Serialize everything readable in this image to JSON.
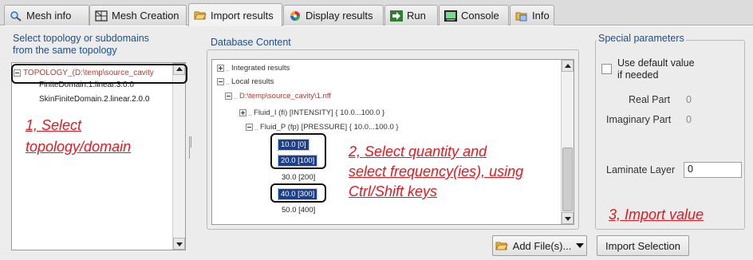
{
  "tabs": [
    {
      "label": "Mesh info",
      "icon": "magnifier-icon",
      "active": false
    },
    {
      "label": "Mesh Creation",
      "icon": "mesh-grid-icon",
      "active": false
    },
    {
      "label": "Import results",
      "icon": "folder-open-icon",
      "active": true
    },
    {
      "label": "Display results",
      "icon": "color-wheel-icon",
      "active": false
    },
    {
      "label": "Run",
      "icon": "run-arrow-icon",
      "active": false
    },
    {
      "label": "Console",
      "icon": "console-icon",
      "active": false
    },
    {
      "label": "Info",
      "icon": "info-folder-icon",
      "active": false
    }
  ],
  "left_panel": {
    "title": "Select topology or subdomains\nfrom the same topology",
    "items": [
      {
        "label": "TOPOLOGY_(D:\\temp\\source_cavity",
        "selected": true,
        "expanded": true
      },
      {
        "label": "FiniteDomain.1.linear.3.0.0"
      },
      {
        "label": "SkinFiniteDomain.2.linear.2.0.0"
      }
    ]
  },
  "db": {
    "title": "Database Content",
    "tree": [
      {
        "label": "Integrated results",
        "expander": "plus"
      },
      {
        "label": "Local results",
        "expander": "minus"
      },
      {
        "label": "D:\\temp\\source_cavity\\1.nff",
        "expander": "minus"
      },
      {
        "label": "Fluid_I (fi) [INTENSITY] { 10.0...100.0 }",
        "expander": "plus"
      },
      {
        "label": "Fluid_P (fp) [PRESSURE] { 10.0...100.0 }",
        "expander": "minus"
      }
    ],
    "frequencies": [
      {
        "label": "10.0 [0]",
        "selected": true
      },
      {
        "label": "20.0 [100]",
        "selected": true
      },
      {
        "label": "30.0 [200]",
        "selected": false
      },
      {
        "label": "40.0 [300]",
        "selected": true
      },
      {
        "label": "50.0 [400]",
        "selected": false
      }
    ]
  },
  "special": {
    "title": "Special parameters",
    "use_default_label": "Use default value\nif needed",
    "use_default_checked": false,
    "real_part_label": "Real Part",
    "real_part_value": "0",
    "imaginary_part_label": "Imaginary Part",
    "imaginary_part_value": "0",
    "laminate_label": "Laminate Layer",
    "laminate_value": "0"
  },
  "buttons": {
    "add_files": "Add File(s)...",
    "import_selection": "Import Selection"
  },
  "annotations": {
    "step1_line1": "1, Select",
    "step1_line2": "topology/domain",
    "step2_line1": "2, Select quantity and",
    "step2_line2": "select frequency(ies), using",
    "step2_line3": "Ctrl/Shift keys",
    "step3": "3, Import value"
  },
  "colors": {
    "accent_blue": "#1d4f8b",
    "selection_blue": "#1b3f8a",
    "annotation_red": "#e8171c",
    "topology_red": "#c0392b"
  }
}
